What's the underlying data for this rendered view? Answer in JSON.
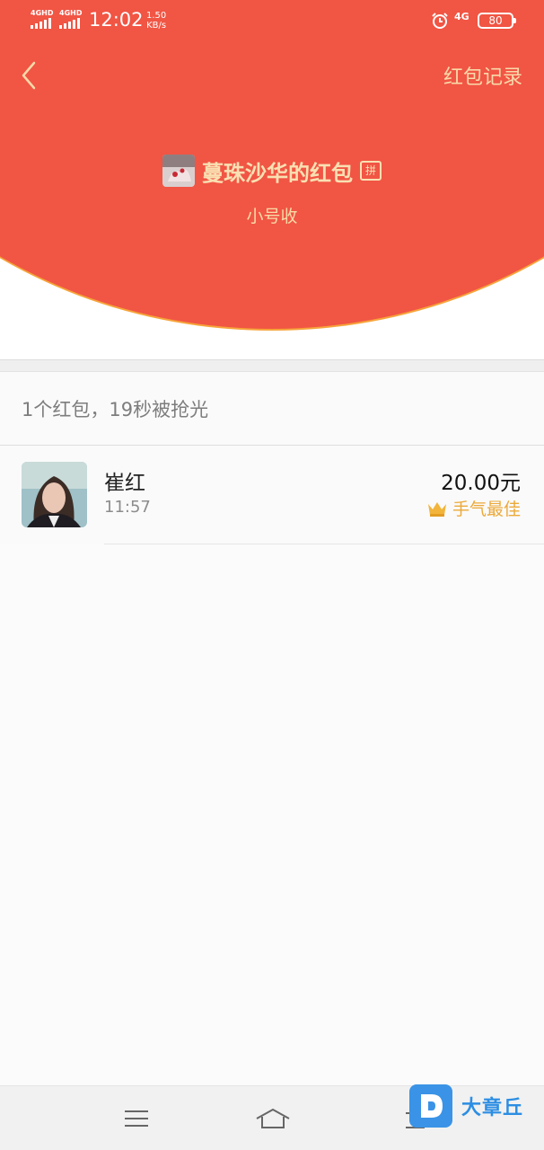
{
  "status_bar": {
    "network_1": "4GHD",
    "network_2": "4GHD",
    "time": "12:02",
    "speed_value": "1.50",
    "speed_unit": "KB/s",
    "network_type": "4G",
    "battery": "80"
  },
  "header": {
    "back_icon": "chevron-left-icon",
    "records_label": "红包记录",
    "sender_name": "蔓珠沙华的红包",
    "pin_badge": "拼",
    "greeting": "小号收",
    "colors": {
      "background": "#f15544",
      "accent_text": "#f9e0b2"
    }
  },
  "summary": {
    "text": "1个红包，19秒被抢光"
  },
  "records": [
    {
      "name": "崔红",
      "time": "11:57",
      "amount": "20.00元",
      "badge": "手气最佳",
      "badge_icon": "crown-icon",
      "badge_color": "#eca93a"
    }
  ],
  "bottom_nav": {
    "items": [
      "menu-icon",
      "home-icon",
      "back-icon"
    ]
  },
  "watermark": {
    "text": "大章丘"
  }
}
